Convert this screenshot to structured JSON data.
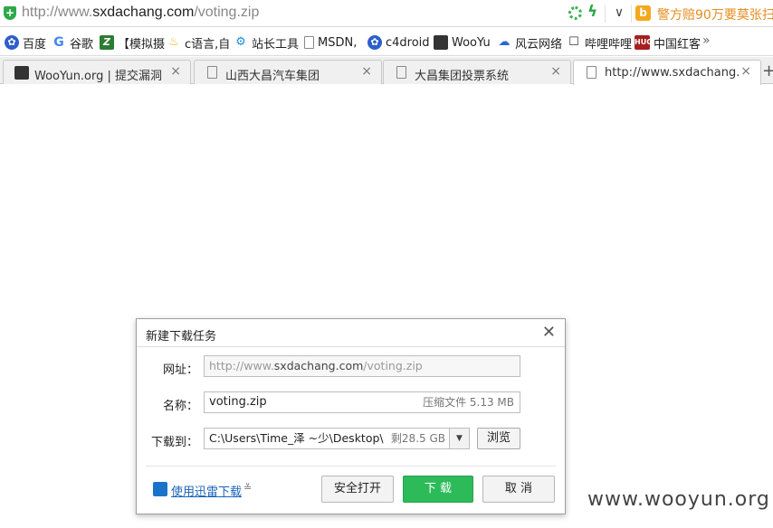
{
  "address_bar": {
    "url_prefix": "http://www.",
    "url_host": "sxdachang.com",
    "url_path": "/voting.zip",
    "search_text": "警方赔90万要莫张扫"
  },
  "bookmarks": [
    {
      "label": "百度",
      "icon": "paw-icon"
    },
    {
      "label": "谷歌",
      "icon": "google-icon"
    },
    {
      "label": "【模拟摄",
      "icon": "z-icon"
    },
    {
      "label": "c语言,自",
      "icon": "bulb-icon"
    },
    {
      "label": "站长工具",
      "icon": "tool-icon"
    },
    {
      "label": "MSDN,",
      "icon": "doc-icon"
    },
    {
      "label": "c4droid",
      "icon": "paw-icon"
    },
    {
      "label": "WooYu",
      "icon": "wooyun-icon"
    },
    {
      "label": "风云网络",
      "icon": "cloud-icon"
    },
    {
      "label": "哔哩哔哩",
      "icon": "tv-icon"
    },
    {
      "label": "中国红客",
      "icon": "huc-icon"
    }
  ],
  "bookmark_icon_text": {
    "z": "Z",
    "huc": "HUC",
    "google": "G"
  },
  "tabs": [
    {
      "label": "WooYun.org | 提交漏洞"
    },
    {
      "label": "山西大昌汽车集团"
    },
    {
      "label": "大昌集团投票系统"
    },
    {
      "label": "http://www.sxdachang.com/voting.zip"
    }
  ],
  "dialog": {
    "title": "新建下载任务",
    "url_label": "网址：",
    "url_prefix": "http://www.",
    "url_host": "sxdachang.com",
    "url_path": "/voting.zip",
    "name_label": "名称：",
    "file_name": "voting.zip",
    "file_meta": "压缩文件 5.13 MB",
    "path_label": "下载到：",
    "save_path": "C:\\Users\\Time_泽 ~少\\Desktop\\",
    "free_space": "剩28.5 GB",
    "browse_label": "浏览",
    "xunlei_link": "使用迅雷下载",
    "safe_open_label": "安全打开",
    "download_label": "下 载",
    "cancel_label": "取 消"
  },
  "watermark": "www.wooyun.org",
  "colors": {
    "accent_green": "#2dbb5a",
    "link_blue": "#1a63b8"
  }
}
